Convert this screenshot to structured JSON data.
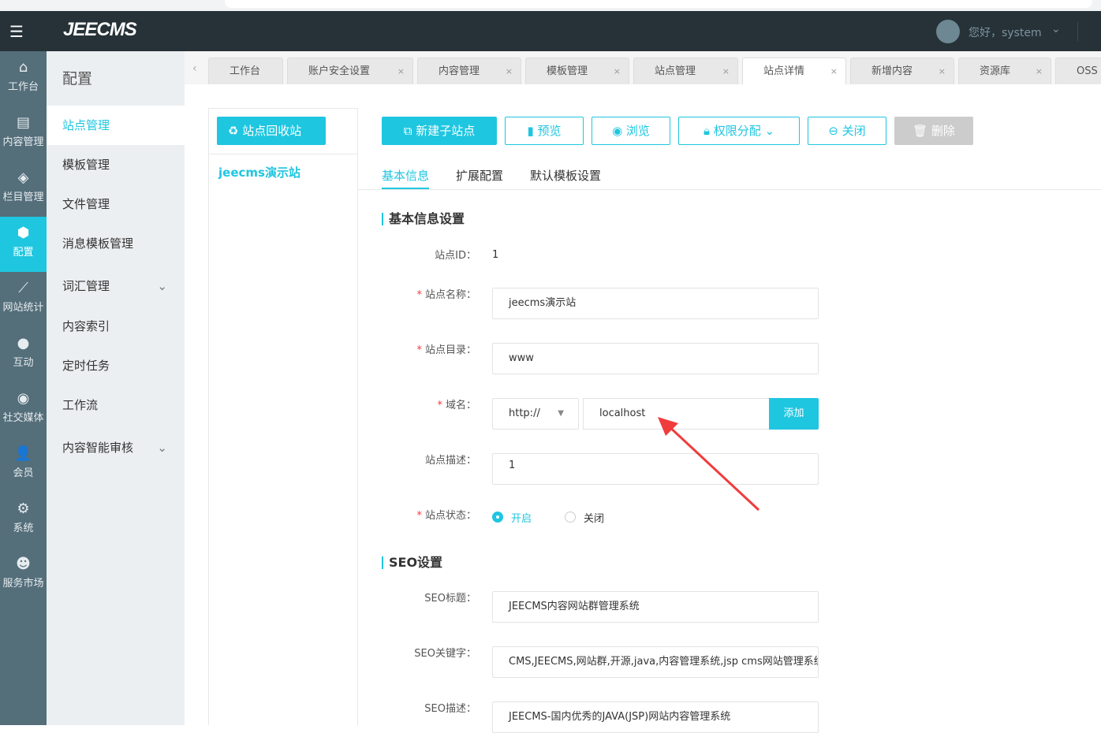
{
  "header": {
    "logo": "JEECMS",
    "greeting": "您好，system"
  },
  "iconbar": [
    {
      "label": "工作台",
      "icon": "home-icon"
    },
    {
      "label": "内容管理",
      "icon": "document-icon"
    },
    {
      "label": "栏目管理",
      "icon": "layers-icon"
    },
    {
      "label": "配置",
      "icon": "cube-icon",
      "active": true
    },
    {
      "label": "网站统计",
      "icon": "chart-icon"
    },
    {
      "label": "互动",
      "icon": "chat-icon"
    },
    {
      "label": "社交媒体",
      "icon": "target-icon"
    },
    {
      "label": "会员",
      "icon": "member-icon"
    },
    {
      "label": "系统",
      "icon": "gear-icon"
    },
    {
      "label": "服务市场",
      "icon": "support-icon"
    }
  ],
  "submenu": {
    "title": "配置",
    "items": [
      {
        "label": "站点管理",
        "active": true
      },
      {
        "label": "模板管理"
      },
      {
        "label": "文件管理"
      },
      {
        "label": "消息模板管理"
      },
      {
        "label": "词汇管理",
        "expandable": true
      },
      {
        "label": "内容索引"
      },
      {
        "label": "定时任务"
      },
      {
        "label": "工作流"
      },
      {
        "label": "内容智能审核",
        "expandable": true
      }
    ]
  },
  "tabs": [
    {
      "label": "工作台"
    },
    {
      "label": "账户安全设置"
    },
    {
      "label": "内容管理"
    },
    {
      "label": "模板管理"
    },
    {
      "label": "站点管理"
    },
    {
      "label": "站点详情",
      "active": true
    },
    {
      "label": "新增内容"
    },
    {
      "label": "资源库"
    },
    {
      "label": "OSS"
    }
  ],
  "sitepanel": {
    "recycle_label": "站点回收站",
    "sites": [
      "jeecms演示站"
    ]
  },
  "toolbar": {
    "new_sub": "新建子站点",
    "preview": "预览",
    "browse": "浏览",
    "permission": "权限分配",
    "close": "关闭",
    "delete": "删除"
  },
  "formtabs": [
    "基本信息",
    "扩展配置",
    "默认模板设置"
  ],
  "basic": {
    "title": "基本信息设置",
    "id_label": "站点ID：",
    "id_value": "1",
    "name_label": "站点名称：",
    "name_value": "jeecms演示站",
    "dir_label": "站点目录：",
    "dir_value": "www",
    "domain_label": "域名：",
    "protocol": "http://",
    "domain_value": "localhost",
    "add_label": "添加",
    "desc_label": "站点描述：",
    "desc_value": "1",
    "status_label": "站点状态：",
    "status_on": "开启",
    "status_off": "关闭",
    "status": "开启"
  },
  "seo": {
    "title": "SEO设置",
    "title_label": "SEO标题：",
    "title_value": "JEECMS内容网站群管理系统",
    "keywords_label": "SEO关键字：",
    "keywords_value": "CMS,JEECMS,网站群,开源,java,内容管理系统,jsp cms网站管理系统",
    "desc_label": "SEO描述：",
    "desc_value": "JEECMS-国内优秀的JAVA(JSP)网站内容管理系统"
  },
  "colors": {
    "accent": "#1fc6e0",
    "header": "#263238",
    "iconbar": "#546e7a",
    "arrow": "#f03c3c"
  }
}
